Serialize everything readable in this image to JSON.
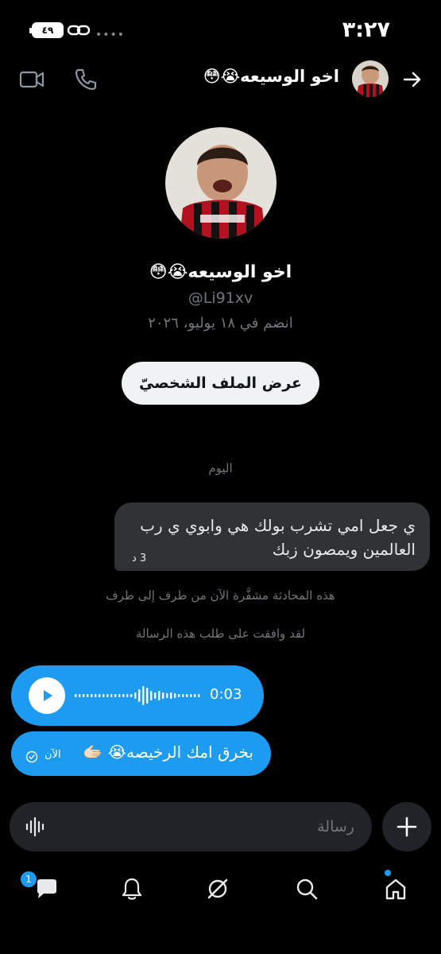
{
  "status_bar": {
    "time": "٣:٢٧",
    "battery": "٤٩"
  },
  "header": {
    "name": "اخو الوسيعه😭😳",
    "back_icon": "arrow-right-icon",
    "phone_icon": "phone-icon",
    "video_icon": "video-icon"
  },
  "profile": {
    "name": "اخو الوسيعه😭😳",
    "handle": "@Li91xv",
    "joined": "انضم في ١٨ يوليو، ٢٠٢٦",
    "view_button": "عرض الملف الشخصيّ"
  },
  "conversation": {
    "day_label": "اليوم",
    "incoming": {
      "text": "ي جعل امي تشرب بولك هي وابوي ي رب العالمين ويمصون زبك",
      "time": "3 د"
    },
    "system_notes": [
      "هذه المحادثة مشفَّرة الآن من طرف إلى طرف",
      "لقد وافقت على طلب هذه الرسالة"
    ],
    "voice": {
      "duration": "0:03"
    },
    "outgoing": {
      "text": "بخرق امك الرخيصه😭 🫱🏻",
      "time": "الآن"
    }
  },
  "composer": {
    "placeholder": "رسالة"
  },
  "nav": {
    "messages_badge": "1"
  },
  "colors": {
    "accent": "#1d9bf0",
    "background": "#000000",
    "bubble_in": "#2f3336",
    "muted_text": "#71767b"
  }
}
